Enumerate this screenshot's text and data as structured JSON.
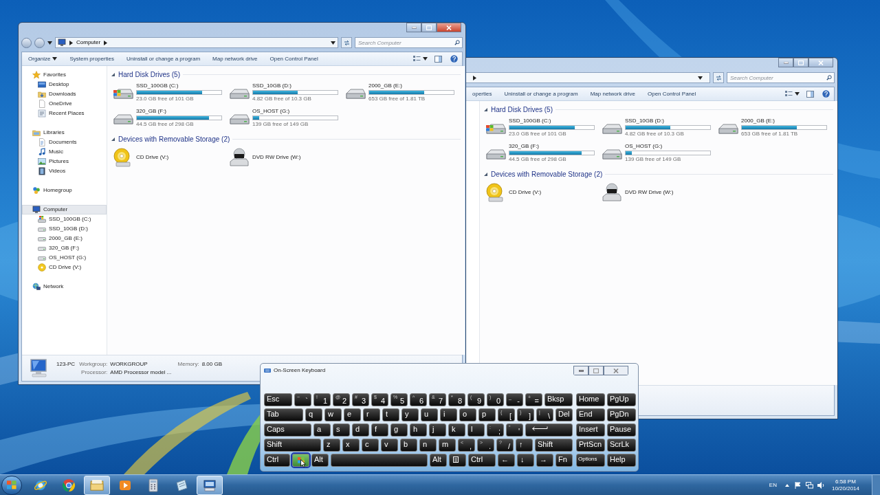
{
  "left_window": {
    "active": true,
    "address": {
      "path": "Computer"
    },
    "search": {
      "placeholder": "Search Computer"
    },
    "toolbar": [
      {
        "label": "Organize",
        "kind": "menu"
      },
      {
        "label": "System properties",
        "kind": "command"
      },
      {
        "label": "Uninstall or change a program",
        "kind": "command"
      },
      {
        "label": "Map network drive",
        "kind": "command"
      },
      {
        "label": "Open Control Panel",
        "kind": "command"
      }
    ],
    "sidebar": [
      {
        "label": "Favorites",
        "kind": "favorites",
        "selected": false,
        "children": [
          {
            "label": "Desktop",
            "kind": "desktop",
            "selected": false
          },
          {
            "label": "Downloads",
            "kind": "downloads",
            "selected": false
          },
          {
            "label": "OneDrive",
            "kind": "page",
            "selected": false
          },
          {
            "label": "Recent Places",
            "kind": "recent",
            "selected": false
          }
        ]
      },
      {
        "label": "Libraries",
        "kind": "libraries",
        "selected": false,
        "children": [
          {
            "label": "Documents",
            "kind": "documents",
            "selected": false
          },
          {
            "label": "Music",
            "kind": "music",
            "selected": false
          },
          {
            "label": "Pictures",
            "kind": "pictures",
            "selected": false
          },
          {
            "label": "Videos",
            "kind": "videos",
            "selected": false
          }
        ]
      },
      {
        "label": "Homegroup",
        "kind": "homegroup",
        "selected": false
      },
      {
        "label": "Computer",
        "kind": "computer",
        "selected": true,
        "children": [
          {
            "label": "SSD_100GB (C:)",
            "kind": "system-drive",
            "selected": false
          },
          {
            "label": "SSD_10GB (D:)",
            "kind": "drive",
            "selected": false
          },
          {
            "label": "2000_GB (E:)",
            "kind": "drive",
            "selected": false
          },
          {
            "label": "320_GB (F:)",
            "kind": "drive",
            "selected": false
          },
          {
            "label": "OS_HOST (G:)",
            "kind": "drive",
            "selected": false
          },
          {
            "label": "CD Drive (V:)",
            "kind": "cd",
            "selected": false
          }
        ]
      },
      {
        "label": "Network",
        "kind": "network",
        "selected": false
      }
    ],
    "groups": [
      {
        "title": "Hard Disk Drives (5)",
        "expanded": true,
        "items": [
          {
            "kind": "system-drive",
            "name": "SSD_100GB (C:)",
            "free": "23.0 GB free of 101 GB",
            "level": 0.77
          },
          {
            "kind": "drive",
            "name": "SSD_10GB (D:)",
            "free": "4.82 GB free of 10.3 GB",
            "level": 0.53
          },
          {
            "kind": "drive",
            "name": "2000_GB (E:)",
            "free": "653 GB free of 1.81 TB",
            "level": 0.65
          },
          {
            "kind": "drive",
            "name": "320_GB (F:)",
            "free": "44.5 GB free of 298 GB",
            "level": 0.85
          },
          {
            "kind": "drive",
            "name": "OS_HOST (G:)",
            "free": "139 GB free of 149 GB",
            "level": 0.07
          }
        ]
      },
      {
        "title": "Devices with Removable Storage (2)",
        "expanded": true,
        "items": [
          {
            "kind": "cd",
            "name": "CD Drive (V:)"
          },
          {
            "kind": "dvd",
            "name": "DVD RW Drive (W:)"
          }
        ]
      }
    ],
    "details": {
      "computer_name": "123-PC",
      "fields": [
        {
          "label": "Workgroup:",
          "value": "WORKGROUP"
        },
        {
          "label": "Memory:",
          "value": "8.00 GB"
        },
        {
          "label": "Processor:",
          "value": "AMD Processor model ..."
        }
      ]
    }
  },
  "right_window": {
    "active": false,
    "search": {
      "placeholder": "Search Computer"
    },
    "toolbar": [
      {
        "label": "operties",
        "kind": "command"
      },
      {
        "label": "Uninstall or change a program",
        "kind": "command"
      },
      {
        "label": "Map network drive",
        "kind": "command"
      },
      {
        "label": "Open Control Panel",
        "kind": "command"
      }
    ],
    "groups": [
      {
        "title": "Hard Disk Drives (5)",
        "expanded": true,
        "items": [
          {
            "kind": "system-drive",
            "name": "SSD_100GB (C:)",
            "free": "23.0 GB free of 101 GB",
            "level": 0.77
          },
          {
            "kind": "drive",
            "name": "SSD_10GB (D:)",
            "free": "4.82 GB free of 10.3 GB",
            "level": 0.53
          },
          {
            "kind": "drive",
            "name": "2000_GB (E:)",
            "free": "653 GB free of 1.81 TB",
            "level": 0.65
          },
          {
            "kind": "drive",
            "name": "320_GB (F:)",
            "free": "44.5 GB free of 298 GB",
            "level": 0.85
          },
          {
            "kind": "drive",
            "name": "OS_HOST (G:)",
            "free": "139 GB free of 149 GB",
            "level": 0.07
          }
        ]
      },
      {
        "title": "Devices with Removable Storage (2)",
        "expanded": true,
        "items": [
          {
            "kind": "cd",
            "name": "CD Drive (V:)"
          },
          {
            "kind": "dvd",
            "name": "DVD RW Drive (W:)"
          }
        ]
      }
    ]
  },
  "keyboard": {
    "title": "On-Screen Keyboard",
    "rows": [
      [
        {
          "label": "Esc",
          "kind": "text",
          "highlighted": false
        },
        {
          "label": "`",
          "shift": "~",
          "kind": "char",
          "highlighted": false
        },
        {
          "label": "1",
          "shift": "!",
          "kind": "char",
          "highlighted": false
        },
        {
          "label": "2",
          "shift": "@",
          "kind": "char",
          "highlighted": false
        },
        {
          "label": "3",
          "shift": "#",
          "kind": "char",
          "highlighted": false
        },
        {
          "label": "4",
          "shift": "$",
          "kind": "char",
          "highlighted": false
        },
        {
          "label": "5",
          "shift": "%",
          "kind": "char",
          "highlighted": false
        },
        {
          "label": "6",
          "shift": "^",
          "kind": "char",
          "highlighted": false
        },
        {
          "label": "7",
          "shift": "&",
          "kind": "char",
          "highlighted": false
        },
        {
          "label": "8",
          "shift": "*",
          "kind": "char",
          "highlighted": false
        },
        {
          "label": "9",
          "shift": "(",
          "kind": "char",
          "highlighted": false
        },
        {
          "label": "0",
          "shift": ")",
          "kind": "char",
          "highlighted": false
        },
        {
          "label": "-",
          "shift": "_",
          "kind": "char",
          "highlighted": false
        },
        {
          "label": "=",
          "shift": "+",
          "kind": "char",
          "highlighted": false
        },
        {
          "label": "Bksp",
          "kind": "text",
          "highlighted": false
        }
      ],
      [
        {
          "label": "Tab",
          "kind": "text",
          "highlighted": false
        },
        {
          "label": "q",
          "kind": "char",
          "highlighted": false
        },
        {
          "label": "w",
          "kind": "char",
          "highlighted": false
        },
        {
          "label": "e",
          "kind": "char",
          "highlighted": false
        },
        {
          "label": "r",
          "kind": "char",
          "highlighted": false
        },
        {
          "label": "t",
          "kind": "char",
          "highlighted": false
        },
        {
          "label": "y",
          "kind": "char",
          "highlighted": false
        },
        {
          "label": "u",
          "kind": "char",
          "highlighted": false
        },
        {
          "label": "i",
          "kind": "char",
          "highlighted": false
        },
        {
          "label": "o",
          "kind": "char",
          "highlighted": false
        },
        {
          "label": "p",
          "kind": "char",
          "highlighted": false
        },
        {
          "label": "[",
          "shift": "{",
          "kind": "char",
          "highlighted": false
        },
        {
          "label": "]",
          "shift": "}",
          "kind": "char",
          "highlighted": false
        },
        {
          "label": "\\",
          "shift": "|",
          "kind": "char",
          "highlighted": false
        },
        {
          "label": "Del",
          "kind": "text",
          "highlighted": false
        }
      ],
      [
        {
          "label": "Caps",
          "kind": "text",
          "highlighted": false
        },
        {
          "label": "a",
          "kind": "char",
          "highlighted": false
        },
        {
          "label": "s",
          "kind": "char",
          "highlighted": false
        },
        {
          "label": "d",
          "kind": "char",
          "highlighted": false
        },
        {
          "label": "f",
          "kind": "char",
          "highlighted": false
        },
        {
          "label": "g",
          "kind": "char",
          "highlighted": false
        },
        {
          "label": "h",
          "kind": "char",
          "highlighted": false
        },
        {
          "label": "j",
          "kind": "char",
          "highlighted": false
        },
        {
          "label": "k",
          "kind": "char",
          "highlighted": false
        },
        {
          "label": "l",
          "kind": "char",
          "highlighted": false
        },
        {
          "label": ";",
          "shift": ":",
          "kind": "char",
          "highlighted": false
        },
        {
          "label": "'",
          "shift": "\"",
          "kind": "char",
          "highlighted": false
        },
        {
          "kind": "enter",
          "highlighted": false
        }
      ],
      [
        {
          "label": "Shift",
          "kind": "text",
          "highlighted": false
        },
        {
          "label": "z",
          "kind": "char",
          "highlighted": false
        },
        {
          "label": "x",
          "kind": "char",
          "highlighted": false
        },
        {
          "label": "c",
          "kind": "char",
          "highlighted": false
        },
        {
          "label": "v",
          "kind": "char",
          "highlighted": false
        },
        {
          "label": "b",
          "kind": "char",
          "highlighted": false
        },
        {
          "label": "n",
          "kind": "char",
          "highlighted": false
        },
        {
          "label": "m",
          "kind": "char",
          "highlighted": false
        },
        {
          "label": ",",
          "shift": "<",
          "kind": "char",
          "highlighted": false
        },
        {
          "label": ".",
          "shift": ">",
          "kind": "char",
          "highlighted": false
        },
        {
          "label": "/",
          "shift": "?",
          "kind": "char",
          "highlighted": false
        },
        {
          "label": "↑",
          "kind": "char",
          "highlighted": false
        },
        {
          "label": "Shift",
          "kind": "text",
          "highlighted": false
        }
      ],
      [
        {
          "label": "Ctrl",
          "kind": "text",
          "highlighted": false
        },
        {
          "kind": "windows",
          "highlighted": true
        },
        {
          "label": "Alt",
          "kind": "text",
          "highlighted": false
        },
        {
          "kind": "space",
          "highlighted": false
        },
        {
          "label": "Alt",
          "kind": "text",
          "highlighted": false
        },
        {
          "kind": "menu",
          "highlighted": false
        },
        {
          "label": "Ctrl",
          "kind": "text",
          "highlighted": false
        },
        {
          "label": "←",
          "kind": "char",
          "highlighted": false
        },
        {
          "label": "↓",
          "kind": "char",
          "highlighted": false
        },
        {
          "label": "→",
          "kind": "char",
          "highlighted": false
        },
        {
          "label": "Fn",
          "kind": "text",
          "highlighted": false
        }
      ]
    ],
    "nav": [
      {
        "label": "Home",
        "kind": "text",
        "highlighted": false
      },
      {
        "label": "PgUp",
        "kind": "text",
        "highlighted": false
      },
      {
        "label": "End",
        "kind": "text",
        "highlighted": false
      },
      {
        "label": "PgDn",
        "kind": "text",
        "highlighted": false
      },
      {
        "label": "Insert",
        "kind": "text",
        "highlighted": false
      },
      {
        "label": "Pause",
        "kind": "text",
        "highlighted": false
      },
      {
        "label": "PrtScn",
        "kind": "text",
        "highlighted": false
      },
      {
        "label": "ScrLk",
        "kind": "text",
        "highlighted": false
      },
      {
        "label": "Options",
        "kind": "small",
        "highlighted": false
      },
      {
        "label": "Help",
        "kind": "text",
        "highlighted": false
      }
    ]
  },
  "taskbar": {
    "apps": [
      {
        "kind": "ie",
        "active": false
      },
      {
        "kind": "chrome",
        "active": false
      },
      {
        "kind": "explorer",
        "active": true
      },
      {
        "kind": "media",
        "active": false
      },
      {
        "kind": "calculator",
        "active": false
      },
      {
        "kind": "notes",
        "active": false
      },
      {
        "kind": "keyboard",
        "active": true
      }
    ],
    "language": "EN",
    "time": "6:58 PM",
    "date": "10/20/2014"
  }
}
